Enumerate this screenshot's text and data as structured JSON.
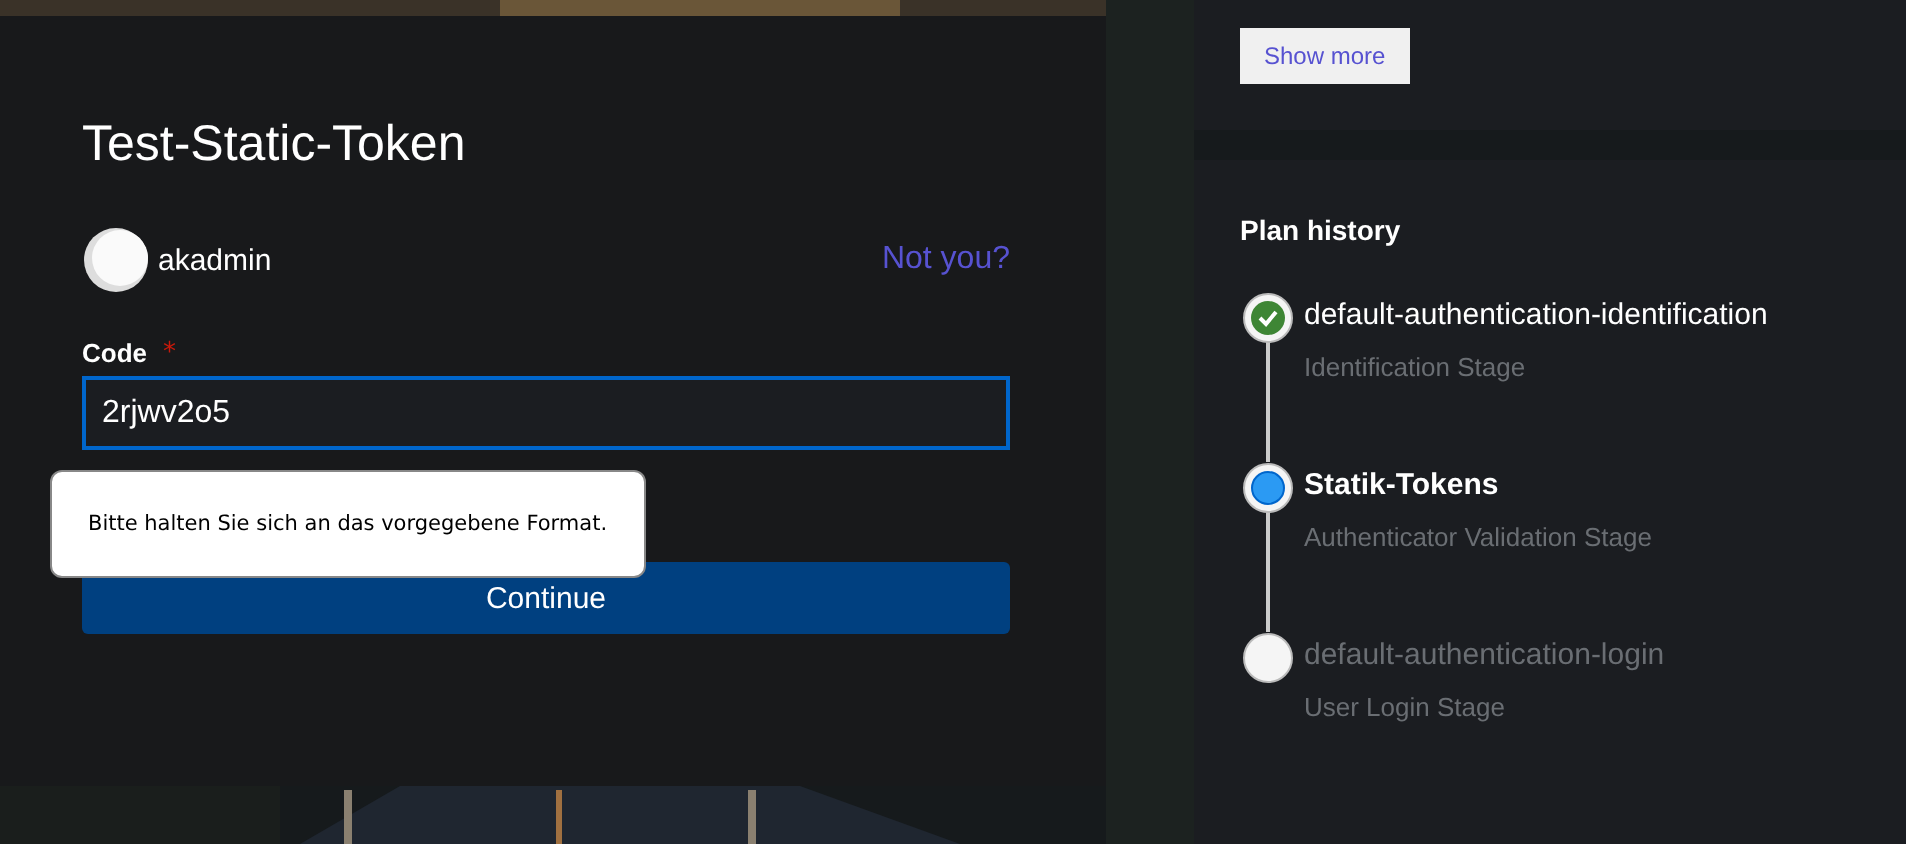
{
  "login_card": {
    "title": "Test-Static-Token",
    "user": {
      "username": "akadmin",
      "link": "Not you?"
    },
    "code_field": {
      "label": "Code",
      "required_mark": "*",
      "value": "2rjwv2o5",
      "focused": true
    },
    "tooltip": "Bitte halten Sie sich an das vorgegebene Format.",
    "submit_button": "Continue"
  },
  "stage_panel": {
    "button": "Show more"
  },
  "plan_history": {
    "title": "Plan history",
    "stages": [
      {
        "name": "default-authentication-identification",
        "description": "Identification Stage",
        "kind": "done"
      },
      {
        "name": "Statik-Tokens",
        "description": "Authenticator Validation Stage",
        "kind": "current"
      },
      {
        "name": "default-authentication-login",
        "description": "User Login Stage",
        "kind": "pending"
      }
    ]
  }
}
